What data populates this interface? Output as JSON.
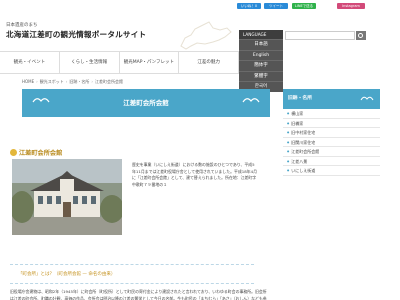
{
  "header": {
    "subtitle": "日本遺産のまち",
    "title": "北海道江差町の観光情報ポータルサイト",
    "sns": [
      "いいね！0",
      "ツイート",
      "LINEで送る",
      "Instagram"
    ]
  },
  "language": {
    "label": "LANGUAGE",
    "items": [
      "日本語",
      "English",
      "簡体字",
      "繁體字",
      "한국어"
    ]
  },
  "search": {
    "placeholder": ""
  },
  "nav": {
    "items": [
      "観光・イベント",
      "くらし・生活情報",
      "観光MAP・パンフレット",
      "江差の魅力"
    ]
  },
  "breadcrumb": [
    "HOME",
    "観光スポット",
    "旧跡・名所",
    "江差町会所会館"
  ],
  "page": {
    "title": "江差町会所会館",
    "section": "江差町会所会館",
    "body1": "歴史を事業（いにしえ街道）における数の施設のひとつであり、平成5年11月までは江差町役場庁舎として使用されていました。平成18年4月に「江差町会所会館」として、建て替えられました。所在地：江差町字中歌町７９番地の１",
    "quote": "「町会所」とは？（町会所会館 — 命名の由来）",
    "body2": "旧役場庁舎建物は、昭和2年（1945年）に町会所（町役所）として町民の寄付金により建設されたと言われており、いわゆる町会の事務所。旧会所は江差の町会所、町職の壮観、高価の作品、会所会は明治以降の江差の繁栄として今日の名前。今も町民の「まちむら」「あさ」（おしん）なども参照します。"
  },
  "sidebar": {
    "heading": "旧跡・名所",
    "items": [
      "横山家",
      "旧橋家",
      "旧中村家住宅",
      "旧関川家住宅",
      "江差町会所会館",
      "江差八景",
      "いにしえ街道"
    ]
  }
}
